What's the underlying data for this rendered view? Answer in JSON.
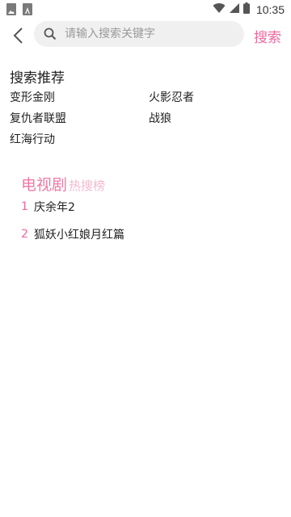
{
  "status_bar": {
    "time": "10:35",
    "icons": [
      "image-icon",
      "font-icon",
      "wifi-icon",
      "cellular-signal-icon",
      "battery-icon"
    ]
  },
  "search": {
    "placeholder": "请输入搜索关键字",
    "value": "",
    "button_label": "搜索"
  },
  "recommendations": {
    "title": "搜索推荐",
    "items": [
      {
        "label": "变形金刚"
      },
      {
        "label": "火影忍者"
      },
      {
        "label": "复仇者联盟"
      },
      {
        "label": "战狼"
      },
      {
        "label": "红海行动"
      }
    ]
  },
  "hot_list": {
    "category": "电视剧",
    "subtitle": "热搜榜",
    "items": [
      {
        "rank": "1",
        "name": "庆余年2"
      },
      {
        "rank": "2",
        "name": "狐妖小红娘月红篇"
      }
    ]
  },
  "colors": {
    "accent": "#f0679c",
    "accent_light": "#f5b8cf",
    "search_bg": "#f0f0f0"
  }
}
